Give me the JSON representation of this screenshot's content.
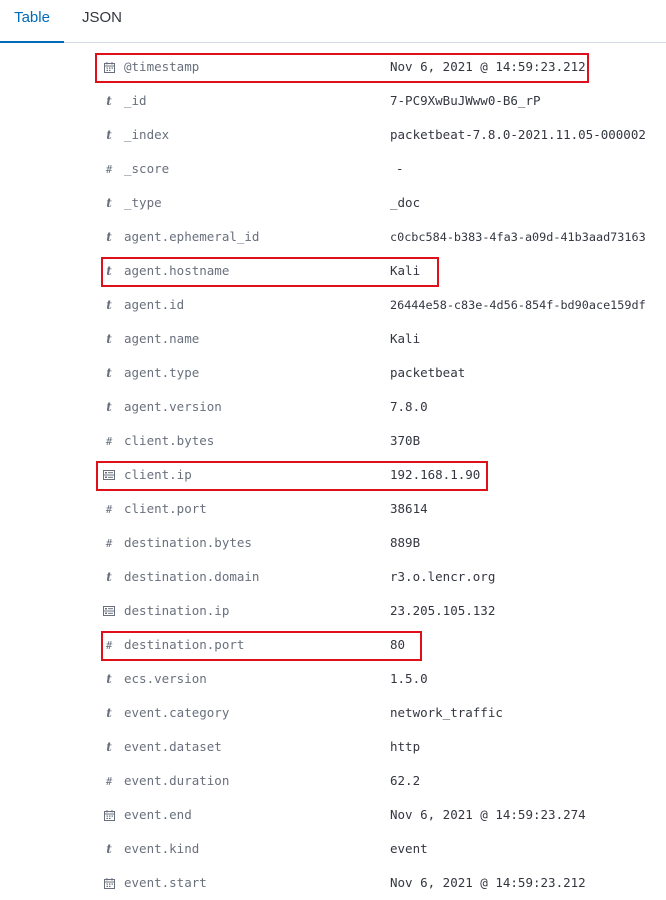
{
  "tabs": {
    "table": "Table",
    "json": "JSON",
    "active": "table"
  },
  "colors": {
    "accent": "#006bb8",
    "highlight_border": "#e0101a",
    "field_name": "#69707d",
    "value": "#343741"
  },
  "fields": [
    {
      "icon": "calendar-icon",
      "name": "@timestamp",
      "value": "Nov 6, 2021 @ 14:59:23.212",
      "highlighted": true
    },
    {
      "icon": "string-icon",
      "name": "_id",
      "value": "7-PC9XwBuJWww0-B6_rP"
    },
    {
      "icon": "string-icon",
      "name": "_index",
      "value": "packetbeat-7.8.0-2021.11.05-000002"
    },
    {
      "icon": "number-icon",
      "name": "_score",
      "value": "-"
    },
    {
      "icon": "string-icon",
      "name": "_type",
      "value": "_doc"
    },
    {
      "icon": "string-icon",
      "name": "agent.ephemeral_id",
      "value": "c0cbc584-b383-4fa3-a09d-41b3aad73163"
    },
    {
      "icon": "string-icon",
      "name": "agent.hostname",
      "value": "Kali",
      "highlighted": true
    },
    {
      "icon": "string-icon",
      "name": "agent.id",
      "value": "26444e58-c83e-4d56-854f-bd90ace159df"
    },
    {
      "icon": "string-icon",
      "name": "agent.name",
      "value": "Kali"
    },
    {
      "icon": "string-icon",
      "name": "agent.type",
      "value": "packetbeat"
    },
    {
      "icon": "string-icon",
      "name": "agent.version",
      "value": "7.8.0"
    },
    {
      "icon": "number-icon",
      "name": "client.bytes",
      "value": "370B"
    },
    {
      "icon": "ip-icon",
      "name": "client.ip",
      "value": "192.168.1.90",
      "highlighted": true
    },
    {
      "icon": "number-icon",
      "name": "client.port",
      "value": "38614"
    },
    {
      "icon": "number-icon",
      "name": "destination.bytes",
      "value": "889B"
    },
    {
      "icon": "string-icon",
      "name": "destination.domain",
      "value": "r3.o.lencr.org"
    },
    {
      "icon": "ip-icon",
      "name": "destination.ip",
      "value": "23.205.105.132"
    },
    {
      "icon": "number-icon",
      "name": "destination.port",
      "value": "80",
      "highlighted": true
    },
    {
      "icon": "string-icon",
      "name": "ecs.version",
      "value": "1.5.0"
    },
    {
      "icon": "string-icon",
      "name": "event.category",
      "value": "network_traffic"
    },
    {
      "icon": "string-icon",
      "name": "event.dataset",
      "value": "http"
    },
    {
      "icon": "number-icon",
      "name": "event.duration",
      "value": "62.2"
    },
    {
      "icon": "calendar-icon",
      "name": "event.end",
      "value": "Nov 6, 2021 @ 14:59:23.274"
    },
    {
      "icon": "string-icon",
      "name": "event.kind",
      "value": "event"
    },
    {
      "icon": "calendar-icon",
      "name": "event.start",
      "value": "Nov 6, 2021 @ 14:59:23.212"
    }
  ]
}
